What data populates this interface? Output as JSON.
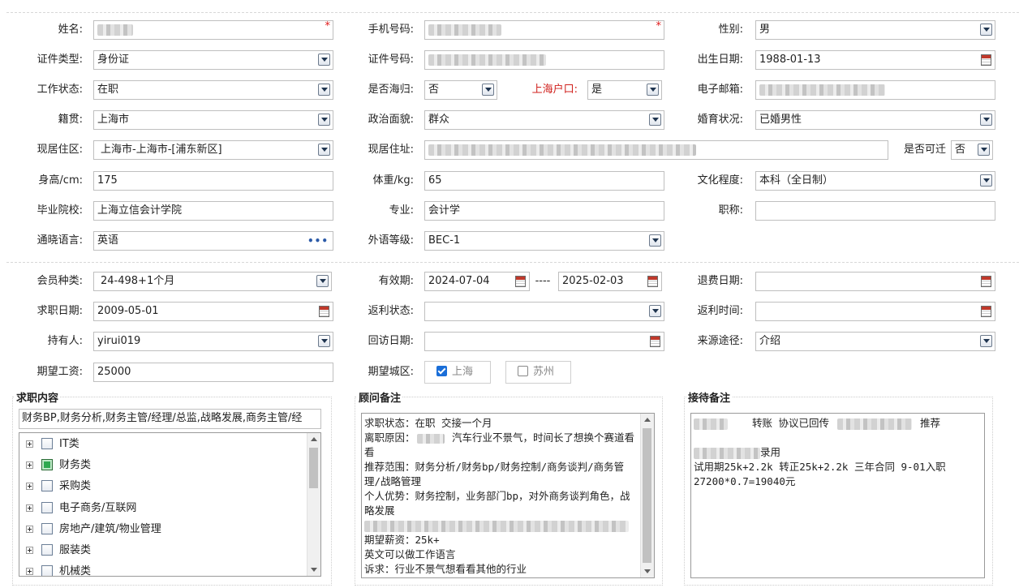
{
  "section1": {
    "name": {
      "label": "姓名:"
    },
    "phone": {
      "label": "手机号码:"
    },
    "gender": {
      "label": "性别:",
      "value": "男"
    },
    "id_type": {
      "label": "证件类型:",
      "value": "身份证"
    },
    "id_no": {
      "label": "证件号码:"
    },
    "birth": {
      "label": "出生日期:",
      "value": "1988-01-13"
    },
    "work_status": {
      "label": "工作状态:",
      "value": "在职"
    },
    "returnee": {
      "label": "是否海归:",
      "value": "否"
    },
    "hukou": {
      "label": "上海户口:",
      "value": "是"
    },
    "email": {
      "label": "电子邮箱:"
    },
    "native": {
      "label": "籍贯:",
      "value": "上海市"
    },
    "political": {
      "label": "政治面貌:",
      "value": "群众"
    },
    "marital": {
      "label": "婚育状况:",
      "value": "已婚男性"
    },
    "residence_area": {
      "label": "现居住区:",
      "value": "上海市-上海市-[浦东新区]"
    },
    "residence_addr": {
      "label": "现居住址:"
    },
    "relocate": {
      "label": "是否可迁",
      "value": "否"
    },
    "height": {
      "label": "身高/cm:",
      "value": "175"
    },
    "weight": {
      "label": "体重/kg:",
      "value": "65"
    },
    "education": {
      "label": "文化程度:",
      "value": "本科（全日制）"
    },
    "school": {
      "label": "毕业院校:",
      "value": "上海立信会计学院"
    },
    "major": {
      "label": "专业:",
      "value": "会计学"
    },
    "title": {
      "label": "职称:",
      "value": ""
    },
    "language": {
      "label": "通晓语言:",
      "value": "英语"
    },
    "lang_level": {
      "label": "外语等级:",
      "value": "BEC-1"
    }
  },
  "section2": {
    "member_type": {
      "label": "会员种类:",
      "value": "24-498+1个月"
    },
    "validity": {
      "label": "有效期:",
      "start": "2024-07-04",
      "sep": "----",
      "end": "2025-02-03"
    },
    "refund_date": {
      "label": "退费日期:",
      "value": ""
    },
    "job_date": {
      "label": "求职日期:",
      "value": "2009-05-01"
    },
    "rebate_status": {
      "label": "返利状态:",
      "value": ""
    },
    "rebate_time": {
      "label": "返利时间:",
      "value": ""
    },
    "holder": {
      "label": "持有人:",
      "value": "yirui019"
    },
    "visit_date": {
      "label": "回访日期:",
      "value": ""
    },
    "source": {
      "label": "来源途径:",
      "value": "介绍"
    },
    "salary": {
      "label": "期望工资:",
      "value": "25000"
    },
    "city": {
      "label": "期望城区:",
      "options": [
        {
          "label": "上海",
          "checked": true
        },
        {
          "label": "苏州",
          "checked": false
        }
      ]
    }
  },
  "job_content": {
    "legend": "求职内容",
    "summary": "财务BP,财务分析,财务主管/经理/总监,战略发展,商务主管/经",
    "tree": [
      {
        "label": "IT类",
        "checked": false
      },
      {
        "label": "财务类",
        "checked": true
      },
      {
        "label": "采购类",
        "checked": false
      },
      {
        "label": "电子商务/互联网",
        "checked": false
      },
      {
        "label": "房地产/建筑/物业管理",
        "checked": false
      },
      {
        "label": "服装类",
        "checked": false
      },
      {
        "label": "机械类",
        "checked": false
      }
    ]
  },
  "advisor_notes": {
    "legend": "顾问备注",
    "lines": [
      "求职状态：在职  交接一个月",
      "离职原因：",
      " 汽车行业不景气，时间长了想换个赛道看看",
      "推荐范围：财务分析/财务bp/财务控制/商务谈判/商务管理/战略管理",
      "个人优势：财务控制，业务部门bp，对外商务谈判角色，战略发展",
      "期望薪资：25k+",
      "英文可以做工作语言",
      "诉求：行业不景气想看看其他的行业"
    ]
  },
  "reception_notes": {
    "legend": "接待备注",
    "lines": [
      "转账  协议已回传",
      "推荐",
      "录用",
      "试用期25k+2.2k 转正25k+2.2k 三年合同 9-01入职",
      "27200*0.7=19040元"
    ]
  }
}
